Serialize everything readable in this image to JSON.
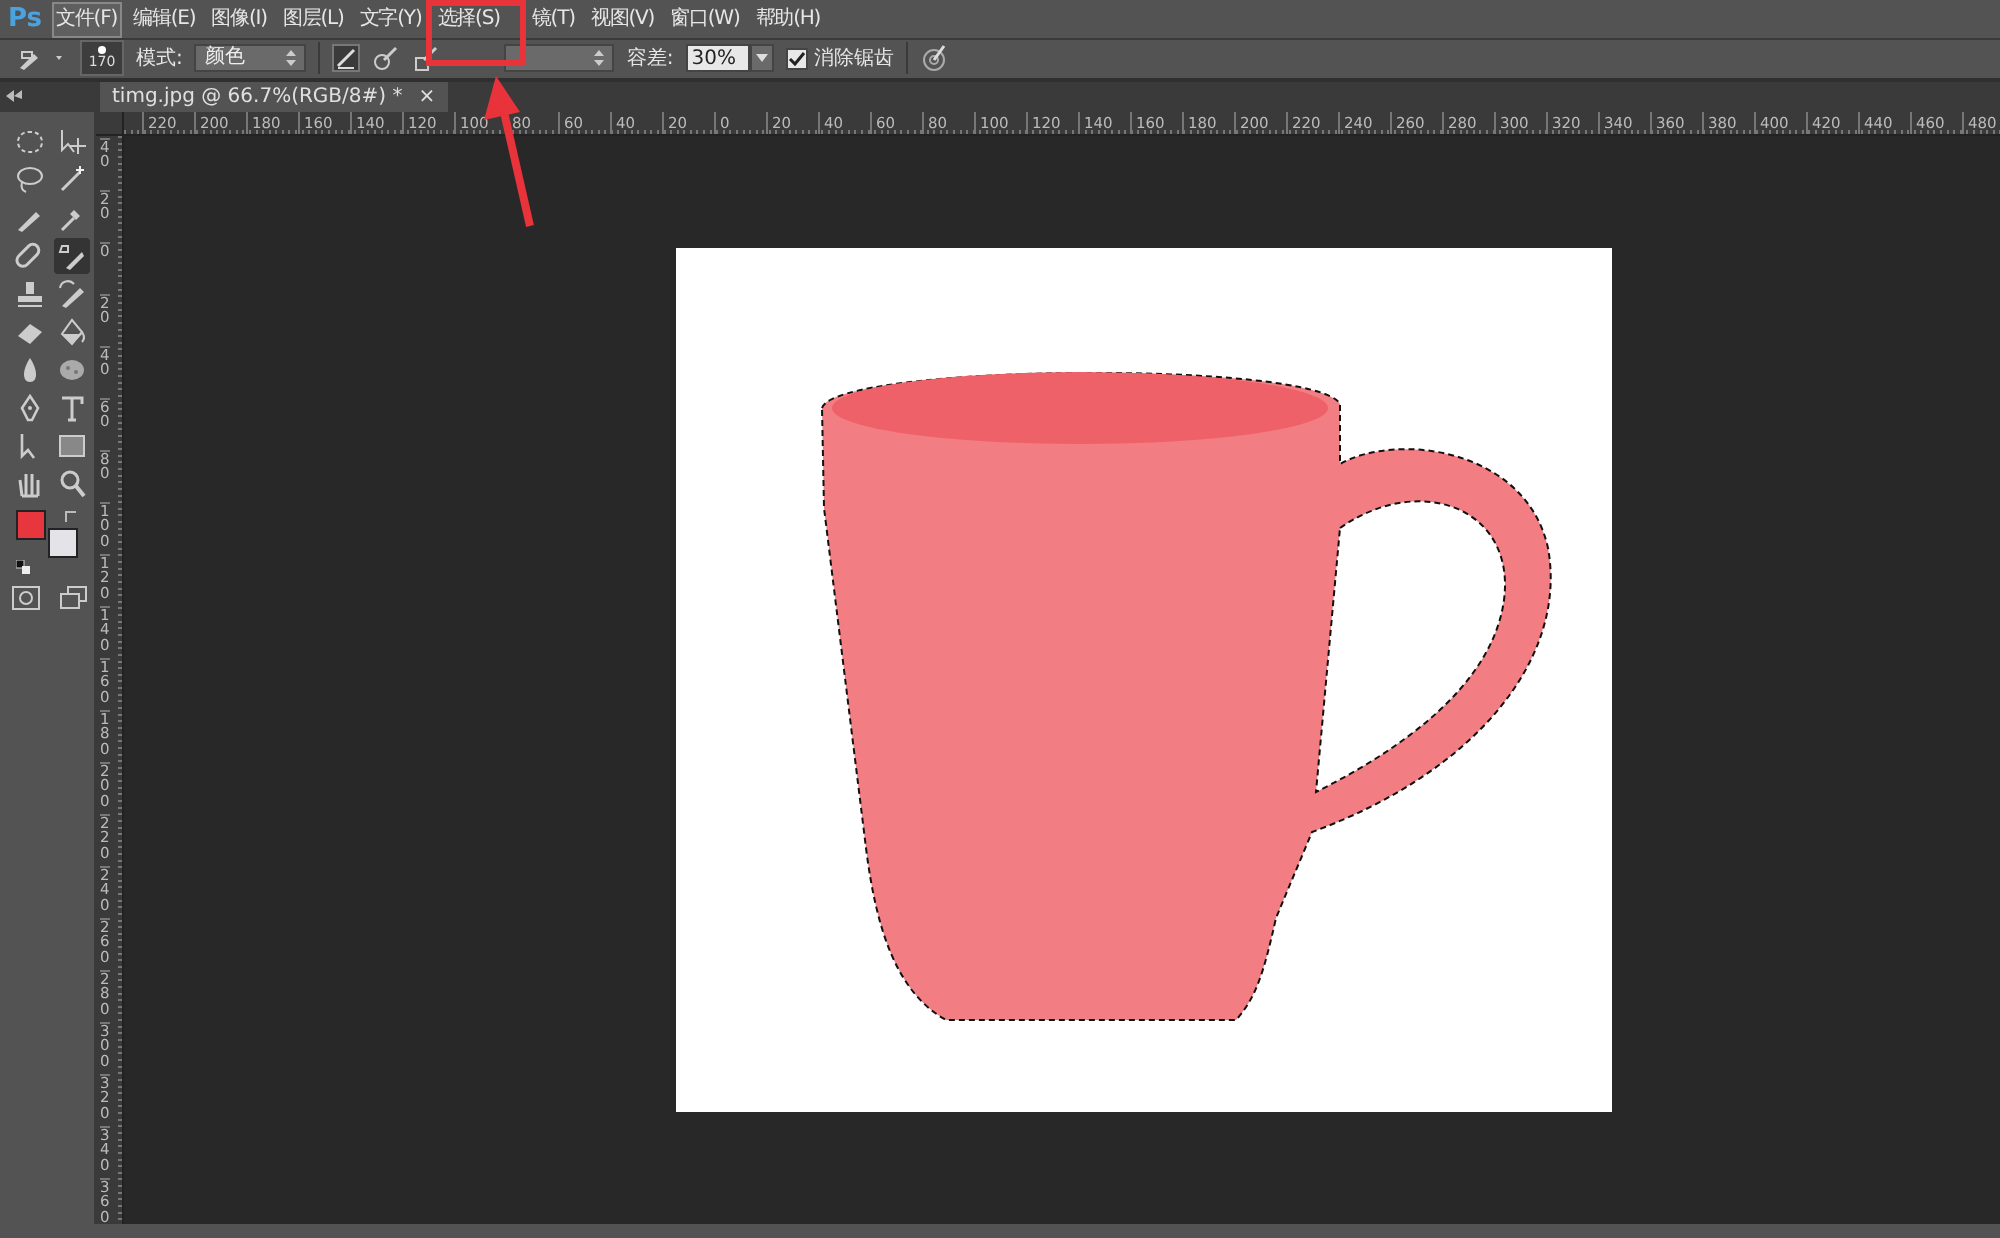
{
  "app_logo": "Ps",
  "menu": [
    {
      "label": "文件(F)",
      "selected": true
    },
    {
      "label": "编辑(E)",
      "selected": false
    },
    {
      "label": "图像(I)",
      "selected": false
    },
    {
      "label": "图层(L)",
      "selected": false
    },
    {
      "label": "文字(Y)",
      "selected": false
    },
    {
      "label": "选择(S)",
      "selected": false
    },
    {
      "label": "镜(T)",
      "selected": false
    },
    {
      "label": "视图(V)",
      "selected": false
    },
    {
      "label": "窗口(W)",
      "selected": false
    },
    {
      "label": "帮助(H)",
      "selected": false
    }
  ],
  "options_bar": {
    "brush_size": "170",
    "mode_label": "模式:",
    "mode_value": "颜色",
    "tolerance_label": "容差:",
    "tolerance_value": "30%",
    "anti_alias": {
      "label": "消除锯齿",
      "checked": true
    }
  },
  "document_tab": {
    "title": "timg.jpg @ 66.7%(RGB/8#) *",
    "close": "×"
  },
  "rulers": {
    "horizontal": [
      "220",
      "200",
      "180",
      "160",
      "140",
      "120",
      "100",
      "80",
      "60",
      "40",
      "20",
      "0",
      "20",
      "40",
      "60",
      "80",
      "100",
      "120",
      "140",
      "160",
      "180",
      "200",
      "220",
      "240",
      "260",
      "280",
      "300",
      "320",
      "340",
      "360",
      "380",
      "400",
      "420",
      "440",
      "460",
      "480"
    ],
    "vertical": [
      "40",
      "20",
      "0",
      "20",
      "40",
      "60",
      "80",
      "100",
      "120",
      "140",
      "160",
      "180",
      "200",
      "220",
      "240",
      "260",
      "280",
      "300",
      "320",
      "340",
      "360"
    ]
  },
  "tools": [
    {
      "selected": false
    },
    {
      "selected": false
    },
    {
      "selected": false
    },
    {
      "selected": false
    },
    {
      "selected": false
    },
    {
      "selected": false
    },
    {
      "selected": false
    },
    {
      "selected": true
    },
    {
      "selected": false
    },
    {
      "selected": false
    },
    {
      "selected": false
    },
    {
      "selected": false
    },
    {
      "selected": false
    },
    {
      "selected": false
    },
    {
      "selected": false
    },
    {
      "selected": false
    },
    {
      "selected": false
    },
    {
      "selected": false
    },
    {
      "selected": false
    },
    {
      "selected": false
    }
  ],
  "swatches": [
    {
      "color": "#e8363f"
    },
    {
      "color": "#e4e4e8"
    }
  ]
}
